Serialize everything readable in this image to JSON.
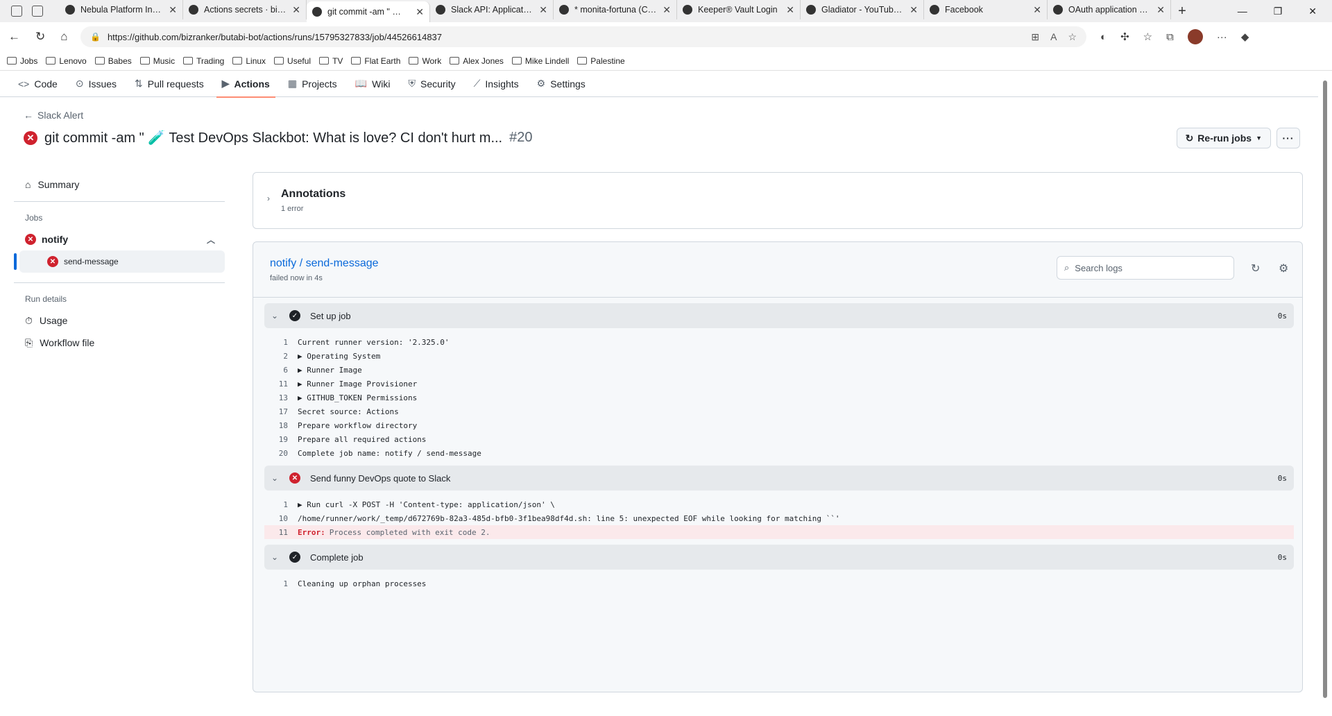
{
  "browser": {
    "tabs": [
      {
        "title": "Nebula Platform Intern",
        "active": false
      },
      {
        "title": "Actions secrets · bizran",
        "active": false
      },
      {
        "title": "git commit -am \" 🧪 T",
        "active": true
      },
      {
        "title": "Slack API: Applications",
        "active": false
      },
      {
        "title": "* monita-fortuna (Cha",
        "active": false
      },
      {
        "title": "Keeper® Vault Login",
        "active": false
      },
      {
        "title": "Gladiator - YouTube T",
        "active": false
      },
      {
        "title": "Facebook",
        "active": false
      },
      {
        "title": "OAuth application aut",
        "active": false
      }
    ],
    "url": "https://github.com/bizranker/butabi-bot/actions/runs/15795327833/job/44526614837",
    "bookmarks": [
      "Jobs",
      "Lenovo",
      "Babes",
      "Music",
      "Trading",
      "Linux",
      "Useful",
      "TV",
      "Flat Earth",
      "Work",
      "Alex Jones",
      "Mike Lindell",
      "Palestine"
    ]
  },
  "repo_nav": [
    {
      "label": "Code",
      "icon": "code-icon"
    },
    {
      "label": "Issues",
      "icon": "issue-icon"
    },
    {
      "label": "Pull requests",
      "icon": "pull-request-icon"
    },
    {
      "label": "Actions",
      "icon": "play-icon",
      "active": true
    },
    {
      "label": "Projects",
      "icon": "table-icon"
    },
    {
      "label": "Wiki",
      "icon": "book-icon"
    },
    {
      "label": "Security",
      "icon": "shield-icon"
    },
    {
      "label": "Insights",
      "icon": "graph-icon"
    },
    {
      "label": "Settings",
      "icon": "gear-icon"
    }
  ],
  "header": {
    "back_label": "Slack Alert",
    "title": "git commit -am \" 🧪 Test DevOps Slackbot: What is love? CI don't hurt m...",
    "run_number": "#20",
    "rerun_label": "Re-run jobs",
    "kebab": "···"
  },
  "sidebar": {
    "summary": "Summary",
    "jobs_heading": "Jobs",
    "job_name": "notify",
    "step_name": "send-message",
    "run_details_heading": "Run details",
    "usage": "Usage",
    "workflow_file": "Workflow file"
  },
  "annotations": {
    "title": "Annotations",
    "subtitle": "1 error"
  },
  "log": {
    "title": "notify / send-message",
    "subtitle": "failed now in 4s",
    "search_placeholder": "Search logs",
    "steps": [
      {
        "name": "Set up job",
        "status": "success",
        "duration": "0s",
        "lines": [
          {
            "n": "1",
            "text": "Current runner version: '2.325.0'"
          },
          {
            "n": "2",
            "text": "▶ Operating System"
          },
          {
            "n": "6",
            "text": "▶ Runner Image"
          },
          {
            "n": "11",
            "text": "▶ Runner Image Provisioner"
          },
          {
            "n": "13",
            "text": "▶ GITHUB_TOKEN Permissions"
          },
          {
            "n": "17",
            "text": "Secret source: Actions"
          },
          {
            "n": "18",
            "text": "Prepare workflow directory"
          },
          {
            "n": "19",
            "text": "Prepare all required actions"
          },
          {
            "n": "20",
            "text": "Complete job name: notify / send-message"
          }
        ]
      },
      {
        "name": "Send funny DevOps quote to Slack",
        "status": "failure",
        "duration": "0s",
        "lines": [
          {
            "n": "1",
            "text": "▶ Run curl -X POST -H 'Content-type: application/json' \\"
          },
          {
            "n": "10",
            "text": "/home/runner/work/_temp/d672769b-82a3-485d-bfb0-3f1bea98df4d.sh: line 5: unexpected EOF while looking for matching ``'"
          },
          {
            "n": "11",
            "error_label": "Error:",
            "text": "Process completed with exit code 2.",
            "error": true
          }
        ]
      },
      {
        "name": "Complete job",
        "status": "success",
        "duration": "0s",
        "lines": [
          {
            "n": "1",
            "text": "Cleaning up orphan processes"
          }
        ]
      }
    ]
  },
  "colors": {
    "error": "#cf222e",
    "link": "#0969da",
    "active_underline": "#fd8c73"
  }
}
